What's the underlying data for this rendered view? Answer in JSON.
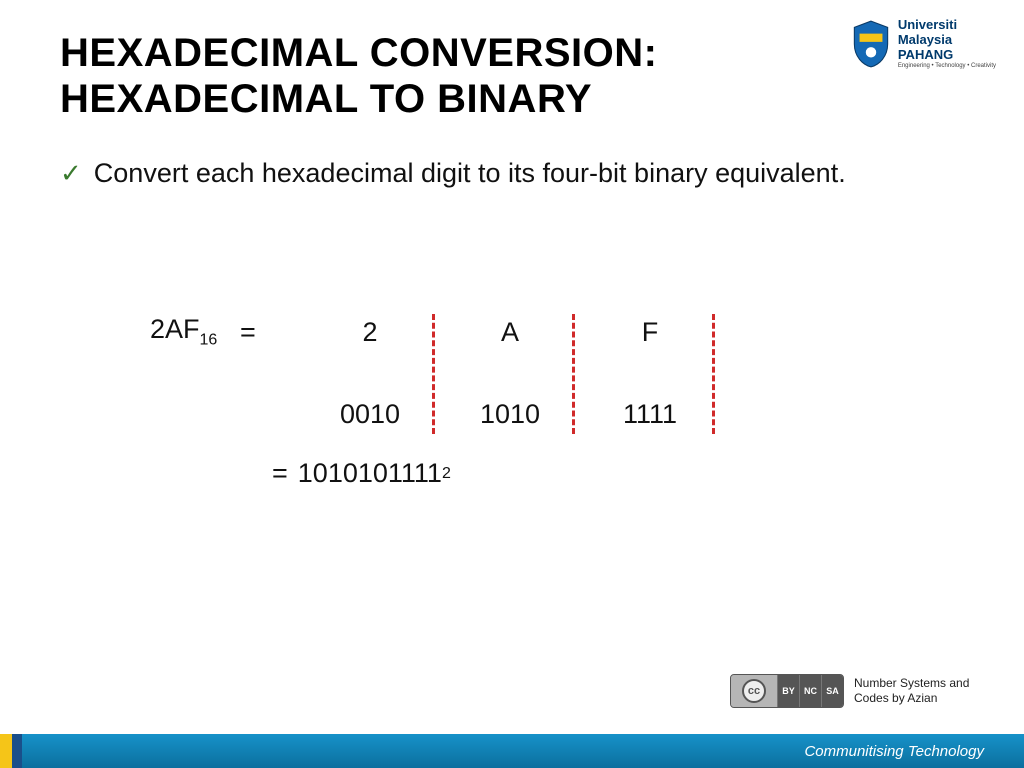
{
  "university": {
    "line1": "Universiti",
    "line2": "Malaysia",
    "line3": "PAHANG",
    "tagline": "Engineering • Technology • Creativity"
  },
  "title": "HEXADECIMAL CONVERSION: HEXADECIMAL TO BINARY",
  "bullet": "Convert each hexadecimal digit to its four-bit binary equivalent.",
  "example": {
    "input_value": "2AF",
    "input_base": "16",
    "eq": "=",
    "digits": [
      "2",
      "A",
      "F"
    ],
    "nibbles": [
      "0010",
      "1010",
      "1111"
    ],
    "result_value": "1010101111",
    "result_base": "2"
  },
  "credit": "Number Systems and Codes by Azian",
  "cc": {
    "label": "cc",
    "parts": [
      "BY",
      "NC",
      "SA"
    ]
  },
  "footer": "Communitising Technology"
}
